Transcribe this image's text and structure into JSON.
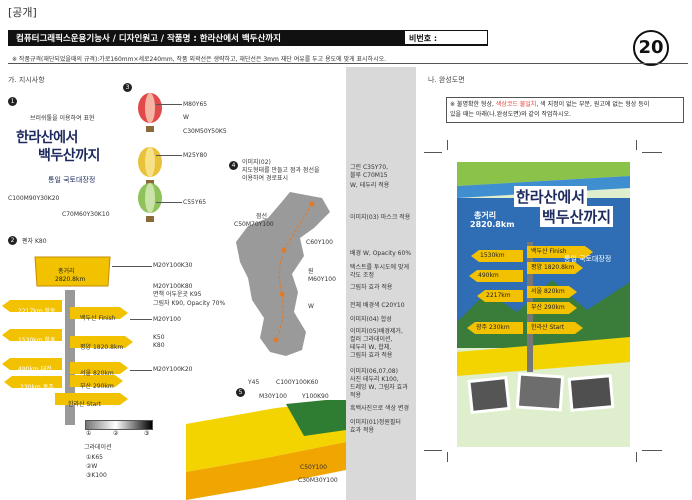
{
  "header": {
    "tag": "[공개]",
    "title": "컴퓨터그래픽스운용기능사  /  디자인원고  /  작품명 : 한라산에서 백두산까지",
    "id_label": "비번호 :",
    "page_number": "20"
  },
  "note": "※ 작품규격(재단되었을때의 규격):가로160mm×세로240mm, 작품 외곽선은 생략하고, 재단선은 3mm 재단 여유를 두고 용도에 맞게 표시하시오.",
  "sections": {
    "left": "가. 지시사항",
    "right": "나. 완성도면"
  },
  "item1": {
    "num": "1",
    "caption": "브러쉬툴을 이용하여 표현",
    "title_line1": "한라산에서",
    "title_line2": "백두산까지",
    "subtitle": "통일 국토대장정",
    "color_a": "C100M90Y30K20",
    "color_b": "C70M60Y30K10"
  },
  "item2": {
    "num": "2",
    "pen": "펜자 K80",
    "top_sign_line1": "총거리",
    "top_sign_line2": "2820.8km",
    "signs": [
      "2217km 항동",
      "백두산 Finish",
      "1530km 함흥",
      "평양 1820.8km",
      "490km 대전",
      "서울 820km",
      "230km 광주",
      "부산 290km",
      "한라산 Start"
    ],
    "labels": [
      "M20Y100K30",
      "M20Y100K80",
      "면책 어두운곳 K95",
      "그림자 K90, Opacity 70%",
      "M20Y100",
      "K50",
      "K80",
      "M20Y100K20"
    ],
    "gradient_title": "그라데이션",
    "gradient_steps": [
      "①K65",
      "②W",
      "③K100"
    ],
    "gradient_marks": [
      "①",
      "②",
      "③"
    ]
  },
  "item3": {
    "num": "3",
    "labels": [
      "M80Y65",
      "W",
      "C30M50Y50K5",
      "M25Y80",
      "C55Y65"
    ]
  },
  "item4": {
    "num": "4",
    "desc": [
      "이미지(02)",
      "지도형태를 만들고 점과 점선을",
      "이용하여 경로표시"
    ],
    "labels": [
      "점선",
      "C50M70Y100",
      "C60Y100",
      "원",
      "M60Y100",
      "W"
    ]
  },
  "item5": {
    "num": "5",
    "labels": [
      "Y45",
      "C100Y100K60",
      "M30Y100",
      "Y100K90",
      "C50Y100",
      "C30M30Y100"
    ]
  },
  "right_note": {
    "line1_pre": "※ 불명확한 형상, ",
    "line1_highlight": "색상코드 불일치",
    "line1_post": ", 색 지정이 없는 부분, 원고에 없는 형상 등이",
    "line2": "있을 때는 아래(나.완성도면)와 같이 작업하시오."
  },
  "right_labels": [
    "그린 C35Y70,",
    "블루 C70M15",
    "W, 테두리 적용",
    "이미지(03) 마스크 적용",
    "배경 W, Opacity 60%",
    "텍스트를 투시도에 맞게",
    "각도 조정",
    "그림자 효과 적용",
    "전체 배경색 C20Y10",
    "이미지(04) 합성",
    "이미지(05)배경제거,",
    "컬러 그라데이션,",
    "테두리 W, 합체,",
    "그림자 효과 적용",
    "이미지(06,07,08)",
    "사진 테두리 K100,",
    "드레잉 W, 그림자 효과",
    "적용",
    "흑백사진으로 색상 변경",
    "이미지(01)정원필터",
    "효과 적용"
  ],
  "poster": {
    "dist_line1": "총거리",
    "dist_line2": "2820.8km",
    "title_line1": "한라산에서",
    "title_line2": "백두산까지",
    "subtitle": "통일 국토대장정",
    "signs": [
      "백두산 Finish",
      "평양 1820.8km",
      "서울 820km",
      "부산 290km",
      "한라산 Start",
      "광주 230km",
      "1530km",
      "490km",
      "2217km"
    ]
  },
  "colors": {
    "navy": "#1d2a5e",
    "sign_yellow": "#f2c200",
    "sign_dark": "#c48a00",
    "poster_bg": "#dfeecd",
    "grey_panel": "#d9d9d9"
  }
}
